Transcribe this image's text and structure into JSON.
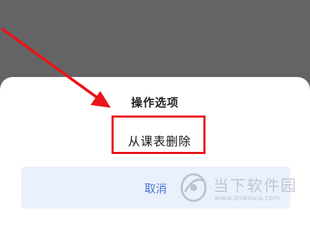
{
  "sheet": {
    "title": "操作选项",
    "action_label": "从课表删除",
    "cancel_label": "取消"
  },
  "annotation": {
    "highlight_color": "#e81519",
    "arrow_color": "#e81519"
  },
  "watermark": {
    "name": "当下软件园",
    "url": "www.downxia.com"
  },
  "colors": {
    "overlay": "#646466",
    "sheet_bg": "#ffffff",
    "cancel_bg": "#eaf0fc",
    "cancel_text": "#4a79d4"
  }
}
